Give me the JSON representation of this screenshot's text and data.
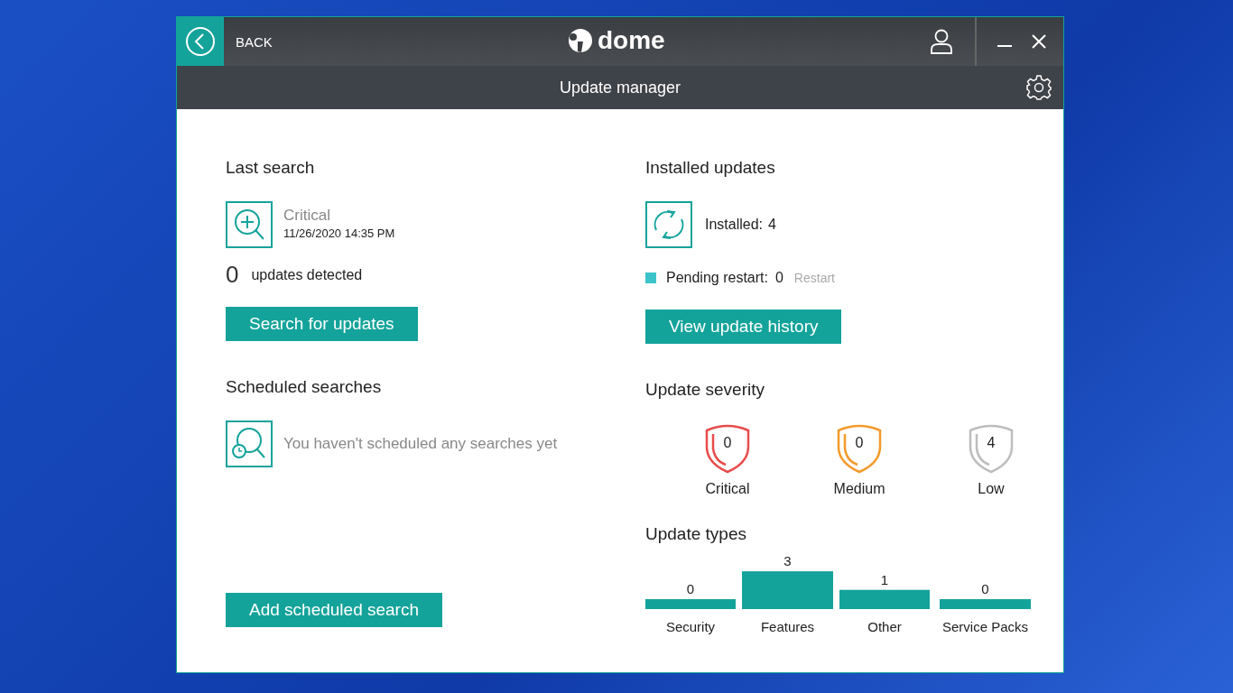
{
  "window": {
    "back_label": "BACK",
    "app_name": "dome",
    "title": "Update manager"
  },
  "last_search": {
    "heading": "Last search",
    "type": "Critical",
    "date": "11/26/2020 14:35 PM",
    "count": "0",
    "count_label": "updates detected",
    "button": "Search for updates"
  },
  "scheduled": {
    "heading": "Scheduled searches",
    "empty_text": "You haven't scheduled any searches yet",
    "button": "Add scheduled search"
  },
  "installed": {
    "heading": "Installed updates",
    "installed_label": "Installed:",
    "installed_count": "4",
    "pending_label": "Pending restart:",
    "pending_count": "0",
    "restart_link": "Restart",
    "button": "View update history"
  },
  "severity": {
    "heading": "Update severity",
    "items": [
      {
        "label": "Critical",
        "count": "0",
        "color": "#e84c4c"
      },
      {
        "label": "Medium",
        "count": "0",
        "color": "#f39a2a"
      },
      {
        "label": "Low",
        "count": "4",
        "color": "#bdbdbd"
      }
    ]
  },
  "types": {
    "heading": "Update types",
    "chart_data": {
      "type": "bar",
      "categories": [
        "Security",
        "Features",
        "Other",
        "Service Packs"
      ],
      "series": [
        {
          "color": "#14a39a",
          "values": [
            0,
            3,
            1,
            0
          ]
        }
      ],
      "data_labels": true
    }
  }
}
